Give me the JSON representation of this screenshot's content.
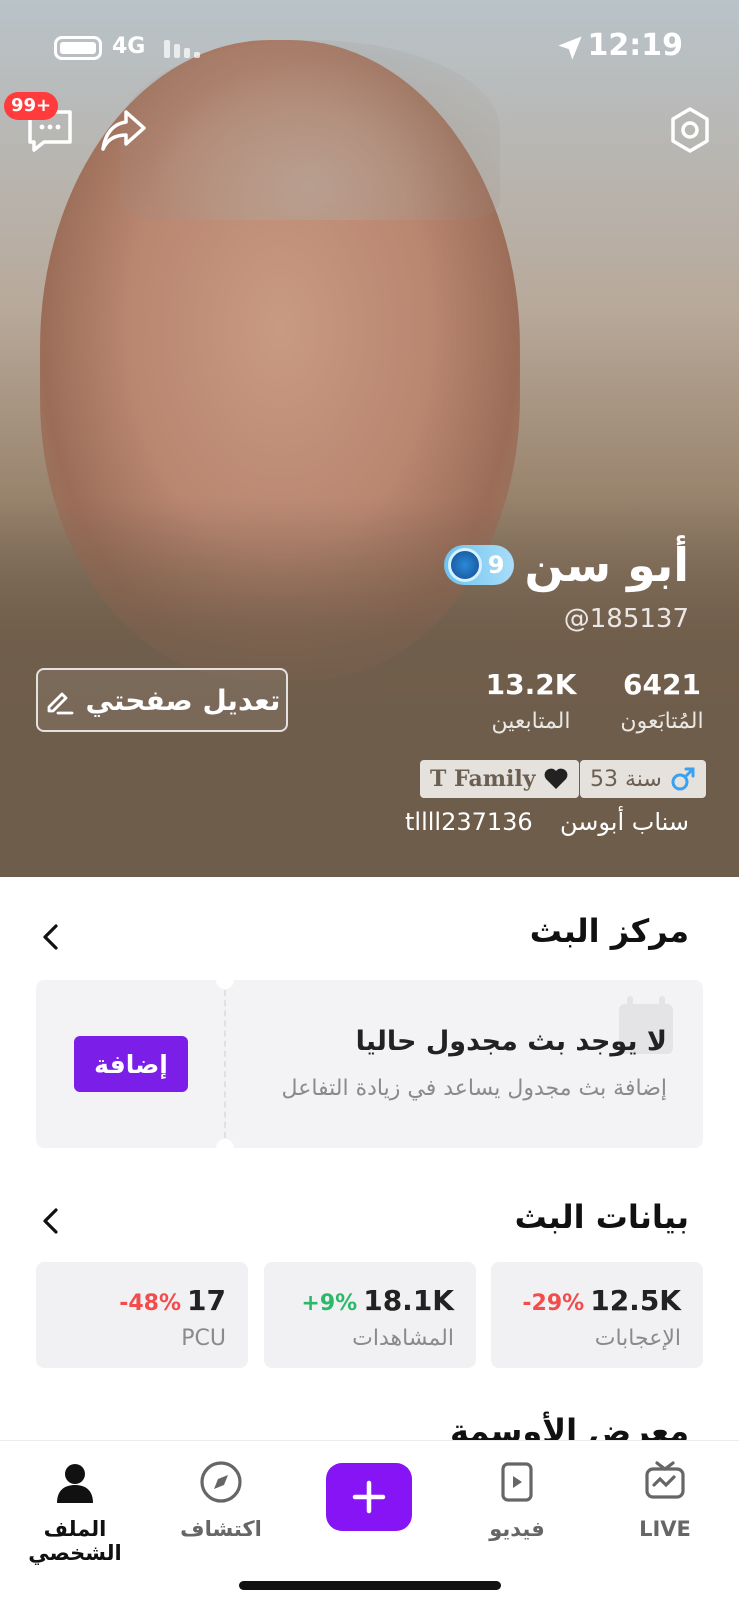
{
  "status_bar": {
    "time": "12:19",
    "network": "4G"
  },
  "header": {
    "notif_badge": "99+"
  },
  "profile": {
    "name": "أبو سن",
    "level": "9",
    "handle": "@185137",
    "following_count": "6421",
    "following_label": "المُتابَعون",
    "followers_count": "13.2K",
    "followers_label": "المتابعين",
    "edit_label": "تعديل صفحتي",
    "age_tag": "53 سنة",
    "family_tag": "T Family",
    "snap_text": "سناب أبوسن",
    "snap_id": "tllll237136"
  },
  "broadcast_center": {
    "title": "مركز البث",
    "empty_title": "لا يوجد بث مجدول حاليا",
    "empty_sub": "إضافة بث مجدول يساعد في زيادة التفاعل",
    "add_label": "إضافة"
  },
  "broadcast_data": {
    "title": "بيانات البث",
    "cards": [
      {
        "value": "12.5K",
        "change": "-29%",
        "label": "الإعجابات",
        "change_color": "#f24c4c"
      },
      {
        "value": "18.1K",
        "change": "+9%",
        "label": "المشاهدات",
        "change_color": "#2bb86b"
      },
      {
        "value": "17",
        "change": "-48%",
        "label": "PCU",
        "change_color": "#f24c4c"
      }
    ]
  },
  "badges_section": {
    "title": "معرض الأوسمة"
  },
  "tabbar": {
    "live": "LIVE",
    "video": "فيديو",
    "explore": "اكتشاف",
    "profile": "الملف الشخصي"
  },
  "colors": {
    "accent": "#8614f5",
    "negative": "#f24c4c",
    "positive": "#2bb86b"
  }
}
